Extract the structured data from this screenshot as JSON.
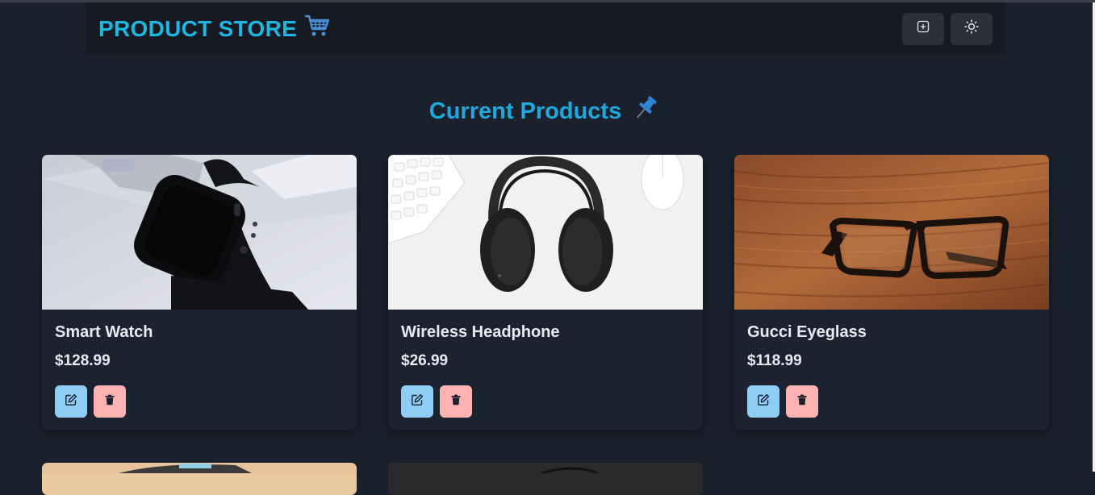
{
  "header": {
    "brand": "PRODUCT STORE",
    "create_icon": "plus-square-icon",
    "theme_icon": "sun-icon"
  },
  "page": {
    "heading": "Current Products"
  },
  "products": [
    {
      "name": "Smart Watch",
      "price": "$128.99",
      "image": "smart-watch-photo"
    },
    {
      "name": "Wireless Headphone",
      "price": "$26.99",
      "image": "headphones-photo"
    },
    {
      "name": "Gucci Eyeglass",
      "price": "$118.99",
      "image": "eyeglasses-photo"
    }
  ],
  "colors": {
    "background": "#1a202c",
    "navbar": "#171923",
    "accent": "#1fb6e0",
    "edit_button": "#90cdf4",
    "delete_button": "#feb2b2"
  }
}
